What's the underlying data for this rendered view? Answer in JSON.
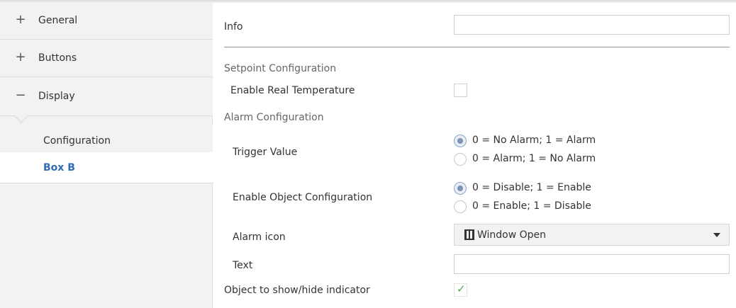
{
  "sidebar": {
    "groups": [
      {
        "sign": "+",
        "label": "General"
      },
      {
        "sign": "+",
        "label": "Buttons"
      },
      {
        "sign": "−",
        "label": "Display"
      }
    ],
    "subitems": [
      {
        "label": "Configuration"
      },
      {
        "label": "Box B"
      }
    ]
  },
  "main": {
    "info_label": "Info",
    "info_value": "",
    "setpoint_section": "Setpoint Configuration",
    "enable_real_temp_label": "Enable Real Temperature",
    "enable_real_temp_checked": false,
    "alarm_section": "Alarm Configuration",
    "trigger_label": "Trigger Value",
    "trigger_options": [
      "0 = No Alarm; 1 = Alarm",
      "0 = Alarm; 1 = No Alarm"
    ],
    "trigger_selected": 0,
    "enable_object_label": "Enable Object Configuration",
    "enable_object_options": [
      "0 = Disable; 1 = Enable",
      "0 = Enable; 1 = Disable"
    ],
    "enable_object_selected": 0,
    "alarm_icon_label": "Alarm icon",
    "alarm_icon_value": "Window Open",
    "alarm_icon_icon": "window-open-icon",
    "text_label": "Text",
    "text_value": "",
    "object_indicator_label": "Object to show/hide indicator",
    "object_indicator_checked": true
  },
  "colors": {
    "sidebar_bg": "#f2f2f2",
    "selected_text": "#2e6db5",
    "check_green": "#5aa060",
    "radio_selected": "#7b93b5"
  }
}
